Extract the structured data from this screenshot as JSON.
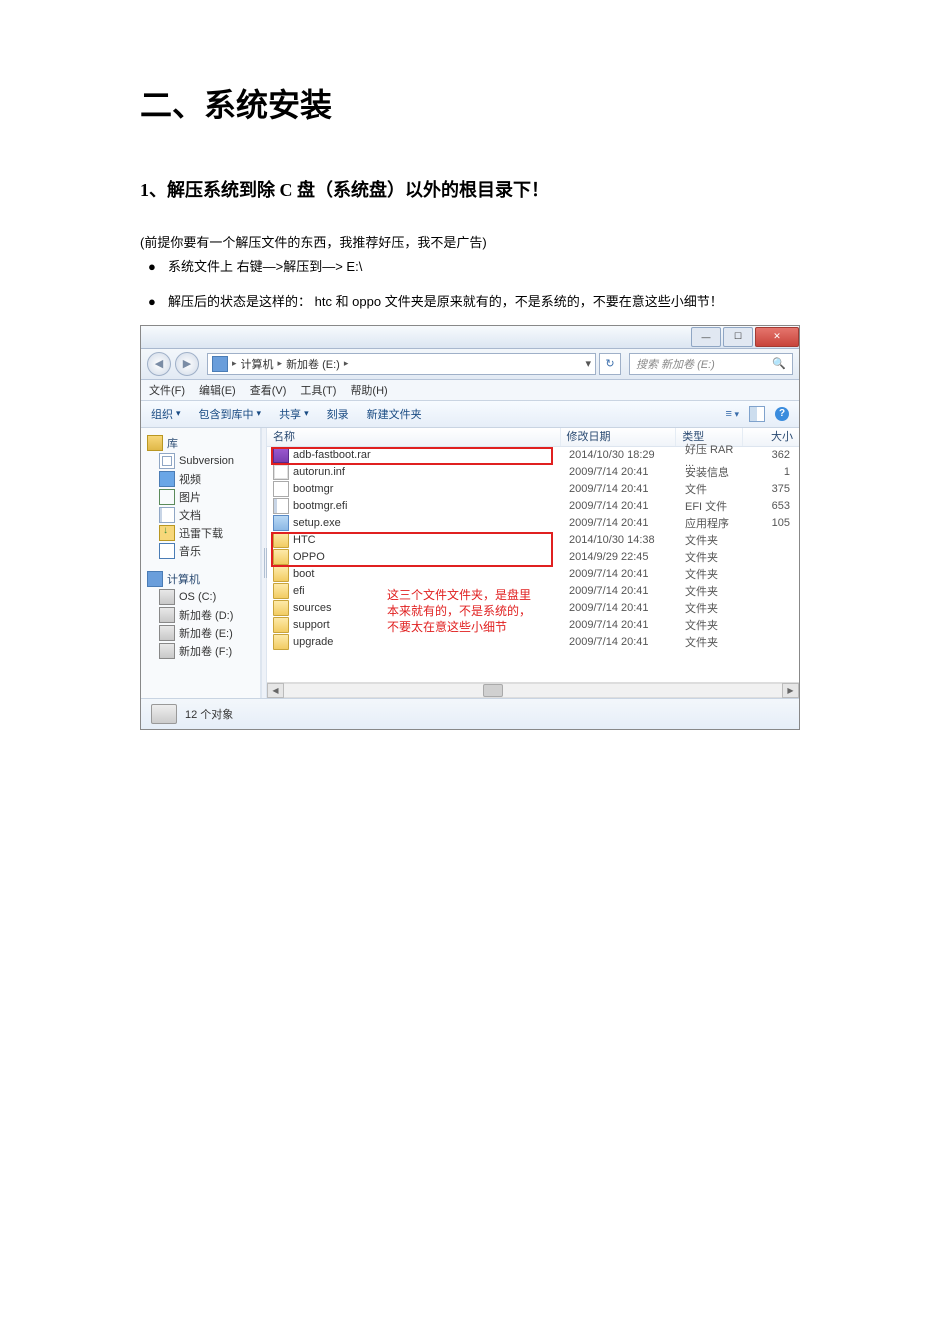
{
  "doc": {
    "title": "二、系统安装",
    "subtitle": "1、解压系统到除 C 盘（系统盘）以外的根目录下！",
    "note": "(前提你要有一个解压文件的东西，我推荐好压，我不是广告)",
    "bullet1": "系统文件上 右键—>解压到—> E:\\",
    "bullet2": "解压后的状态是这样的：  htc 和 oppo 文件夹是原来就有的，不是系统的，不要在意这些小细节！"
  },
  "window": {
    "min": "—",
    "max": "☐",
    "close": "✕"
  },
  "nav": {
    "back": "◀",
    "fwd": "▶",
    "crumb1": "计算机",
    "crumb2": "新加卷 (E:)",
    "refresh": "↻",
    "search_placeholder": "搜索 新加卷 (E:)",
    "search_icon": "🔍"
  },
  "menu": {
    "file": "文件(F)",
    "edit": "编辑(E)",
    "view": "查看(V)",
    "tools": "工具(T)",
    "help": "帮助(H)"
  },
  "toolbar": {
    "organize": "组织",
    "include": "包含到库中",
    "share": "共享",
    "burn": "刻录",
    "newfolder": "新建文件夹",
    "views": "≡",
    "help": "?"
  },
  "sidebar": {
    "lib": "库",
    "items_lib": [
      {
        "label": "Subversion",
        "icon": "ic-svn"
      },
      {
        "label": "视频",
        "icon": "ic-video"
      },
      {
        "label": "图片",
        "icon": "ic-pic"
      },
      {
        "label": "文档",
        "icon": "ic-doc"
      },
      {
        "label": "迅雷下载",
        "icon": "ic-dl"
      },
      {
        "label": "音乐",
        "icon": "ic-music"
      }
    ],
    "pc": "计算机",
    "items_pc": [
      {
        "label": "OS (C:)",
        "icon": "ic-drive"
      },
      {
        "label": "新加卷 (D:)",
        "icon": "ic-drive"
      },
      {
        "label": "新加卷 (E:)",
        "icon": "ic-drive"
      },
      {
        "label": "新加卷 (F:)",
        "icon": "ic-drive"
      }
    ]
  },
  "columns": {
    "name": "名称",
    "date": "修改日期",
    "type": "类型",
    "size": "大小"
  },
  "files": [
    {
      "name": "adb-fastboot.rar",
      "date": "2014/10/30 18:29",
      "type": "好压 RAR ...",
      "size": "362",
      "icon": "fi-rar"
    },
    {
      "name": "autorun.inf",
      "date": "2009/7/14 20:41",
      "type": "安装信息",
      "size": "1",
      "icon": "fi-inf"
    },
    {
      "name": "bootmgr",
      "date": "2009/7/14 20:41",
      "type": "文件",
      "size": "375",
      "icon": "fi-file"
    },
    {
      "name": "bootmgr.efi",
      "date": "2009/7/14 20:41",
      "type": "EFI 文件",
      "size": "653",
      "icon": "fi-efi"
    },
    {
      "name": "setup.exe",
      "date": "2009/7/14 20:41",
      "type": "应用程序",
      "size": "105",
      "icon": "fi-exe"
    },
    {
      "name": "HTC",
      "date": "2014/10/30 14:38",
      "type": "文件夹",
      "size": "",
      "icon": "fi-folder"
    },
    {
      "name": "OPPO",
      "date": "2014/9/29 22:45",
      "type": "文件夹",
      "size": "",
      "icon": "fi-folder"
    },
    {
      "name": "boot",
      "date": "2009/7/14 20:41",
      "type": "文件夹",
      "size": "",
      "icon": "fi-folder"
    },
    {
      "name": "efi",
      "date": "2009/7/14 20:41",
      "type": "文件夹",
      "size": "",
      "icon": "fi-folder"
    },
    {
      "name": "sources",
      "date": "2009/7/14 20:41",
      "type": "文件夹",
      "size": "",
      "icon": "fi-folder"
    },
    {
      "name": "support",
      "date": "2009/7/14 20:41",
      "type": "文件夹",
      "size": "",
      "icon": "fi-folder"
    },
    {
      "name": "upgrade",
      "date": "2009/7/14 20:41",
      "type": "文件夹",
      "size": "",
      "icon": "fi-folder"
    }
  ],
  "annotation": {
    "line1": "这三个文件文件夹，是盘里",
    "line2": "本来就有的，不是系统的，",
    "line3": "不要太在意这些小细节"
  },
  "status": {
    "text": "12 个对象"
  }
}
